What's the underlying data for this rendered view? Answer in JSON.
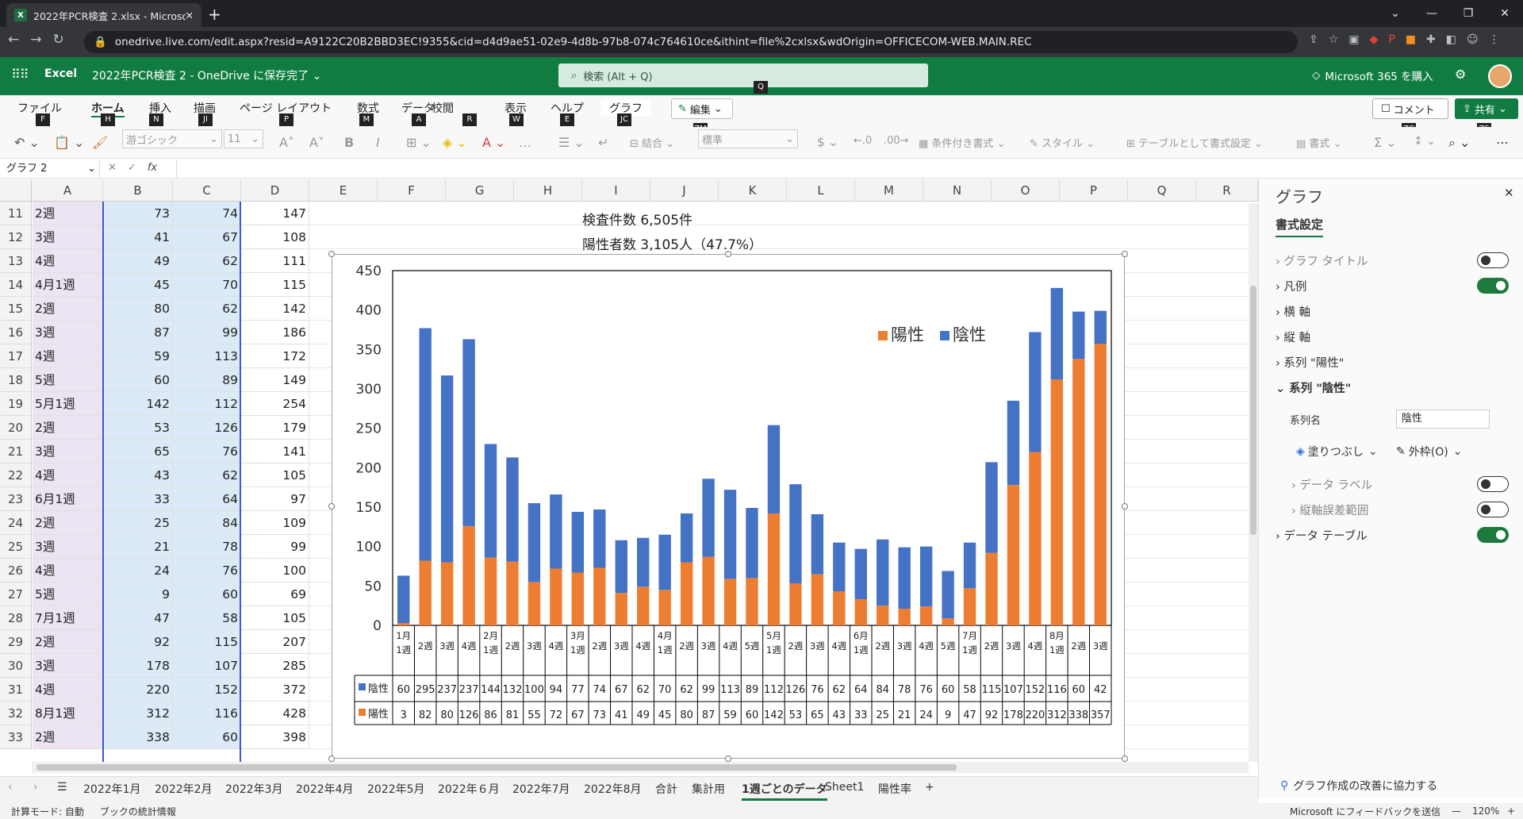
{
  "browser": {
    "tab_title": "2022年PCR検査 2.xlsx - Microsoft",
    "url": "onedrive.live.com/edit.aspx?resid=A9122C20B2BBD3EC!9355&cid=d4d9ae51-02e9-4d8b-97b8-074c764610ce&ithint=file%2cxlsx&wdOrigin=OFFICECOM-WEB.MAIN.REC"
  },
  "header": {
    "app_name": "Excel",
    "doc_name": "2022年PCR検査 2 - OneDrive に保存完了 ⌄",
    "search_placeholder": "検索 (Alt + Q)",
    "search_key": "Q",
    "buy_label": "Microsoft 365 を購入"
  },
  "ribbon": {
    "tabs": [
      {
        "label": "ファイル",
        "key": "F"
      },
      {
        "label": "ホーム",
        "key": "H"
      },
      {
        "label": "挿入",
        "key": "N"
      },
      {
        "label": "描画",
        "key": "JI"
      },
      {
        "label": "ページ レイアウト",
        "key": "P"
      },
      {
        "label": "数式",
        "key": "M"
      },
      {
        "label": "データ",
        "key": "A"
      },
      {
        "label": "校閲",
        "key": "R"
      },
      {
        "label": "表示",
        "key": "W"
      },
      {
        "label": "ヘルプ",
        "key": "E"
      },
      {
        "label": "グラフ",
        "key": "JC"
      }
    ],
    "edit_label": "編集",
    "edit_key": "ZM",
    "comment_label": "コメント",
    "comment_key": "ZC",
    "share_label": "共有",
    "share_key": "ZS",
    "font_name": "游ゴシック",
    "font_size": "11",
    "merge_label": "結合",
    "number_format": "標準",
    "cond_format": "条件付き書式",
    "styles": "スタイル",
    "table_format": "テーブルとして書式設定",
    "format": "書式",
    "zr_key": "ZR"
  },
  "formula_bar": {
    "name_box": "グラフ 2",
    "fx": "fx"
  },
  "grid": {
    "columns": [
      "A",
      "B",
      "C",
      "D",
      "E",
      "F",
      "G",
      "H",
      "I",
      "J",
      "K",
      "L",
      "M",
      "N",
      "O",
      "P",
      "Q",
      "R"
    ],
    "rows": [
      {
        "n": "11",
        "a": "2週",
        "b": "73",
        "c": "74",
        "d": "147"
      },
      {
        "n": "12",
        "a": "3週",
        "b": "41",
        "c": "67",
        "d": "108"
      },
      {
        "n": "13",
        "a": "4週",
        "b": "49",
        "c": "62",
        "d": "111"
      },
      {
        "n": "14",
        "a": "4月1週",
        "b": "45",
        "c": "70",
        "d": "115"
      },
      {
        "n": "15",
        "a": "2週",
        "b": "80",
        "c": "62",
        "d": "142"
      },
      {
        "n": "16",
        "a": "3週",
        "b": "87",
        "c": "99",
        "d": "186"
      },
      {
        "n": "17",
        "a": "4週",
        "b": "59",
        "c": "113",
        "d": "172"
      },
      {
        "n": "18",
        "a": "5週",
        "b": "60",
        "c": "89",
        "d": "149"
      },
      {
        "n": "19",
        "a": "5月1週",
        "b": "142",
        "c": "112",
        "d": "254"
      },
      {
        "n": "20",
        "a": "2週",
        "b": "53",
        "c": "126",
        "d": "179"
      },
      {
        "n": "21",
        "a": "3週",
        "b": "65",
        "c": "76",
        "d": "141"
      },
      {
        "n": "22",
        "a": "4週",
        "b": "43",
        "c": "62",
        "d": "105"
      },
      {
        "n": "23",
        "a": "6月1週",
        "b": "33",
        "c": "64",
        "d": "97"
      },
      {
        "n": "24",
        "a": "2週",
        "b": "25",
        "c": "84",
        "d": "109"
      },
      {
        "n": "25",
        "a": "3週",
        "b": "21",
        "c": "78",
        "d": "99"
      },
      {
        "n": "26",
        "a": "4週",
        "b": "24",
        "c": "76",
        "d": "100"
      },
      {
        "n": "27",
        "a": "5週",
        "b": "9",
        "c": "60",
        "d": "69"
      },
      {
        "n": "28",
        "a": "7月1週",
        "b": "47",
        "c": "58",
        "d": "105"
      },
      {
        "n": "29",
        "a": "2週",
        "b": "92",
        "c": "115",
        "d": "207"
      },
      {
        "n": "30",
        "a": "3週",
        "b": "178",
        "c": "107",
        "d": "285"
      },
      {
        "n": "31",
        "a": "4週",
        "b": "220",
        "c": "152",
        "d": "372"
      },
      {
        "n": "32",
        "a": "8月1週",
        "b": "312",
        "c": "116",
        "d": "428"
      },
      {
        "n": "33",
        "a": "2週",
        "b": "338",
        "c": "60",
        "d": "398"
      }
    ],
    "info_line1": "検査件数 6,505件",
    "info_line2": "陽性者数 3,105人（47.7%）"
  },
  "chart_data": {
    "type": "bar",
    "stacked": true,
    "categories": [
      "1月1週",
      "2週",
      "3週",
      "4週",
      "2月1週",
      "2週",
      "3週",
      "4週",
      "3月1週",
      "2週",
      "3週",
      "4週",
      "4月1週",
      "2週",
      "3週",
      "4週",
      "5週",
      "5月1週",
      "2週",
      "3週",
      "4週",
      "6月1週",
      "2週",
      "3週",
      "4週",
      "5週",
      "7月1週",
      "2週",
      "3週",
      "4週",
      "8月1週",
      "2週",
      "3週"
    ],
    "series": [
      {
        "name": "陽性",
        "color": "#ed7d31",
        "values": [
          3,
          82,
          80,
          126,
          86,
          81,
          55,
          72,
          67,
          73,
          41,
          49,
          45,
          80,
          87,
          59,
          60,
          142,
          53,
          65,
          43,
          33,
          25,
          21,
          24,
          9,
          47,
          92,
          178,
          220,
          312,
          338,
          357
        ]
      },
      {
        "name": "陰性",
        "color": "#4472c4",
        "values": [
          60,
          295,
          237,
          237,
          144,
          132,
          100,
          94,
          77,
          74,
          67,
          62,
          70,
          62,
          99,
          113,
          89,
          112,
          126,
          76,
          62,
          64,
          84,
          78,
          76,
          60,
          58,
          115,
          107,
          152,
          116,
          60,
          42
        ]
      }
    ],
    "ylim": [
      0,
      450
    ],
    "yticks": [
      "0",
      "50",
      "100",
      "150",
      "200",
      "250",
      "300",
      "350",
      "400",
      "450"
    ],
    "legend": "top-right",
    "data_table": true
  },
  "panel": {
    "title": "グラフ",
    "subtitle": "書式設定",
    "items": [
      {
        "label": "グラフ タイトル",
        "toggle": false
      },
      {
        "label": "凡例",
        "toggle": true
      },
      {
        "label": "横 軸"
      },
      {
        "label": "縦 軸"
      },
      {
        "label": "系列 \"陽性\""
      },
      {
        "label": "系列 \"陰性\""
      }
    ],
    "series_name_label": "系列名",
    "series_name_value": "陰性",
    "fill_label": "塗りつぶし",
    "border_label": "外枠(O)",
    "data_label": "データ ラベル",
    "error_bar": "縦軸誤差範囲",
    "data_table": "データ テーブル",
    "feedback": "グラフ作成の改善に協力する"
  },
  "sheets": [
    "2022年1月",
    "2022年2月",
    "2022年3月",
    "2022年4月",
    "2022年5月",
    "2022年６月",
    "2022年7月",
    "2022年8月",
    "合計",
    "集計用",
    "1週ごとのデータ",
    "Sheet1",
    "陽性率"
  ],
  "active_sheet_index": 10,
  "status": {
    "calc_mode": "計算モード: 自動",
    "stats": "ブックの統計情報",
    "feedback": "Microsoft にフィードバックを送信",
    "zoom": "120%"
  }
}
